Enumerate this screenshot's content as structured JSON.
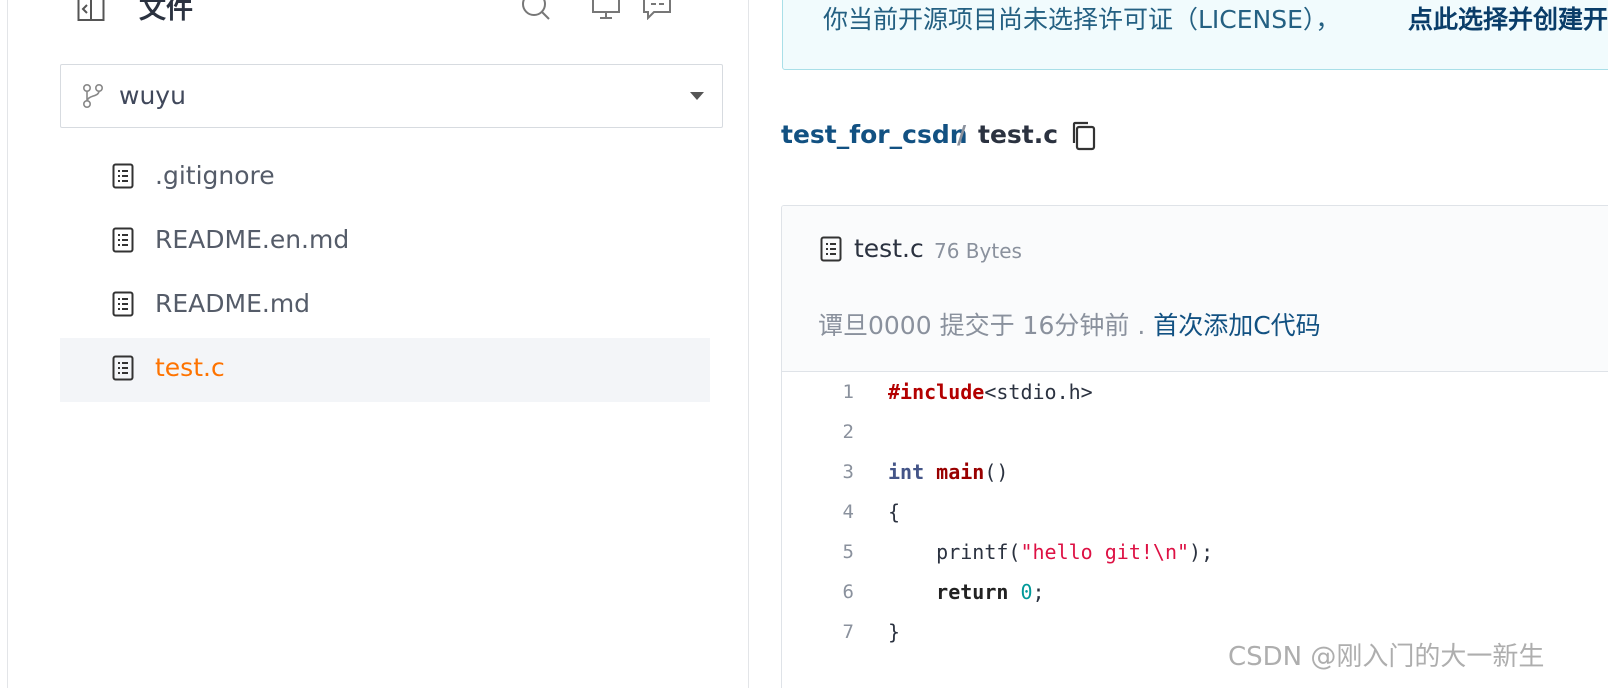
{
  "sidebar": {
    "title": "文件",
    "branch": {
      "label": "wuyu"
    },
    "files": [
      {
        "name": ".gitignore",
        "active": false
      },
      {
        "name": "README.en.md",
        "active": false
      },
      {
        "name": "README.md",
        "active": false
      },
      {
        "name": "test.c",
        "active": true
      }
    ]
  },
  "license_notice": {
    "text": "你当前开源项目尚未选择许可证（LICENSE），",
    "link": "点此选择并创建开"
  },
  "breadcrumb": {
    "repo": "test_for_csdn",
    "separator": "/",
    "file": "test.c"
  },
  "file_panel": {
    "name": "test.c",
    "size": "76 Bytes",
    "commit": {
      "author": "谭旦0000",
      "action": "提交于",
      "time": "16分钟前",
      "dot": ".",
      "message": "首次添加C代码"
    },
    "lines": [
      {
        "n": "1",
        "tokens": [
          {
            "t": "#include",
            "c": "pre"
          },
          {
            "t": "<stdio.h>",
            "c": ""
          }
        ]
      },
      {
        "n": "2",
        "tokens": []
      },
      {
        "n": "3",
        "tokens": [
          {
            "t": "int",
            "c": "type"
          },
          {
            "t": " ",
            "c": ""
          },
          {
            "t": "main",
            "c": "fn"
          },
          {
            "t": "()",
            "c": ""
          }
        ]
      },
      {
        "n": "4",
        "tokens": [
          {
            "t": "{",
            "c": ""
          }
        ]
      },
      {
        "n": "5",
        "tokens": [
          {
            "t": "    printf(",
            "c": ""
          },
          {
            "t": "\"hello git!\\n\"",
            "c": "str"
          },
          {
            "t": ");",
            "c": ""
          }
        ]
      },
      {
        "n": "6",
        "tokens": [
          {
            "t": "    ",
            "c": ""
          },
          {
            "t": "return",
            "c": "kw"
          },
          {
            "t": " ",
            "c": ""
          },
          {
            "t": "0",
            "c": "num"
          },
          {
            "t": ";",
            "c": ""
          }
        ]
      },
      {
        "n": "7",
        "tokens": [
          {
            "t": "}",
            "c": ""
          }
        ]
      }
    ]
  },
  "watermark": "CSDN @刚入门的大一新生"
}
